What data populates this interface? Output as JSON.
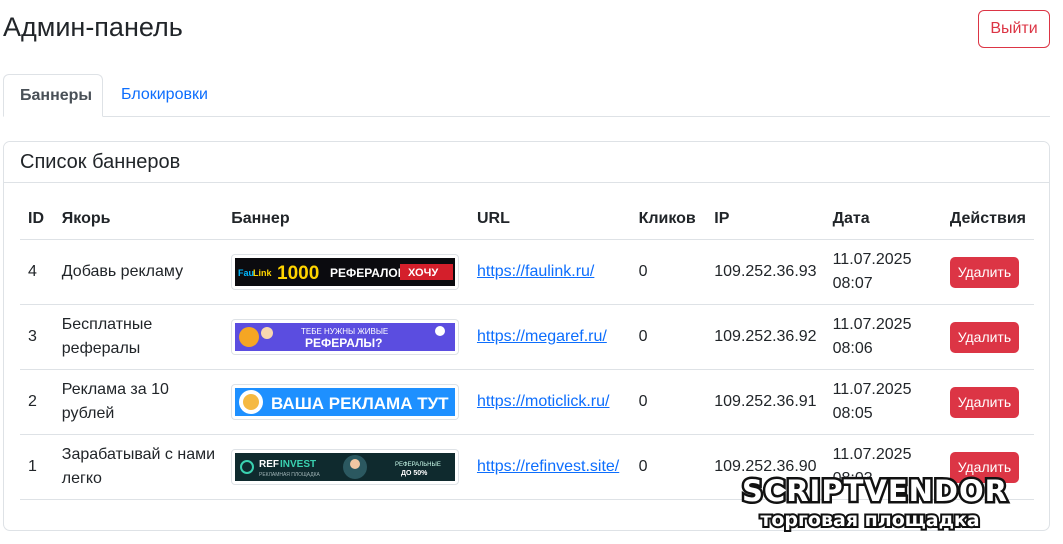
{
  "header": {
    "title": "Админ-панель",
    "logout_label": "Выйти"
  },
  "tabs": [
    {
      "label": "Баннеры",
      "active": true
    },
    {
      "label": "Блокировки",
      "active": false
    }
  ],
  "card": {
    "title": "Список баннеров"
  },
  "table": {
    "columns": [
      "ID",
      "Якорь",
      "Баннер",
      "URL",
      "Кликов",
      "IP",
      "Дата",
      "Действия"
    ],
    "rows": [
      {
        "id": "4",
        "anchor": "Добавь рекламу",
        "banner_text": [
          "Fau",
          "Link",
          "1000",
          "РЕФЕРАЛОВ?",
          "ХОЧУ"
        ],
        "url": "https://faulink.ru/",
        "clicks": "0",
        "ip": "109.252.36.93",
        "date": "11.07.2025",
        "time": "08:07",
        "action": "Удалить"
      },
      {
        "id": "3",
        "anchor": "Бесплатные рефералы",
        "banner_text": [
          "ТЕБЕ НУЖНЫ ЖИВЫЕ",
          "РЕФЕРАЛЫ?"
        ],
        "url": "https://megaref.ru/",
        "clicks": "0",
        "ip": "109.252.36.92",
        "date": "11.07.2025",
        "time": "08:06",
        "action": "Удалить"
      },
      {
        "id": "2",
        "anchor": "Реклама за 10 рублей",
        "banner_text": [
          "ВАША РЕКЛАМА ТУТ"
        ],
        "url": "https://moticlick.ru/",
        "clicks": "0",
        "ip": "109.252.36.91",
        "date": "11.07.2025",
        "time": "08:05",
        "action": "Удалить"
      },
      {
        "id": "1",
        "anchor": "Зарабатывай с нами легко",
        "banner_text": [
          "REF",
          "INVEST",
          "РЕКЛАМНАЯ ПЛОЩАДКА",
          "РЕФЕРАЛЬНЫЕ",
          "ДО 50%"
        ],
        "url": "https://refinvest.site/",
        "clicks": "0",
        "ip": "109.252.36.90",
        "date": "11.07.2025",
        "time": "08:03",
        "action": "Удалить"
      }
    ]
  },
  "watermark": {
    "brand": "SCRIPTVENDOR",
    "tagline": "торговая площадка"
  },
  "colors": {
    "primary": "#0d6efd",
    "danger": "#dc3545",
    "border": "#dee2e6",
    "text": "#212529"
  }
}
